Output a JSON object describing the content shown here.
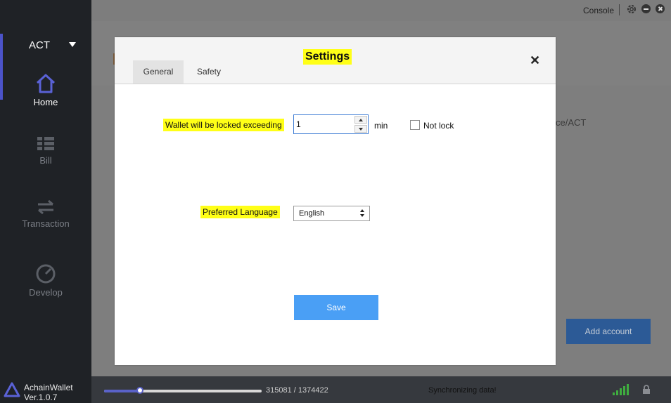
{
  "sidebar": {
    "account": "ACT",
    "items": [
      {
        "label": "Home",
        "icon": "home-icon"
      },
      {
        "label": "Bill",
        "icon": "list-icon"
      },
      {
        "label": "Transaction",
        "icon": "transfer-icon"
      },
      {
        "label": "Develop",
        "icon": "gauge-icon"
      }
    ],
    "brand_name": "AchainWallet",
    "version": "Ver.1.0.7"
  },
  "topbar": {
    "console_label": "Console"
  },
  "background": {
    "partial_text": "ce/ACT",
    "add_account_label": "Add account"
  },
  "status_bar": {
    "blocks": "315081 / 1374422",
    "progress": 0.229,
    "message": "Synchronizing data!"
  },
  "dialog": {
    "title": "Settings",
    "tabs": [
      {
        "label": "General",
        "active": true
      },
      {
        "label": "Safety",
        "active": false
      }
    ],
    "lock_label": "Wallet will be locked exceeding",
    "lock_value": "1",
    "lock_unit": "min",
    "not_lock_label": "Not lock",
    "not_lock_checked": false,
    "language_label": "Preferred Language",
    "language_value": "English",
    "save_label": "Save"
  },
  "colors": {
    "accent": "#4b53c9",
    "highlight": "#ffff17",
    "save_button": "#4a9ff5",
    "sidebar_bg": "#1f2226"
  }
}
